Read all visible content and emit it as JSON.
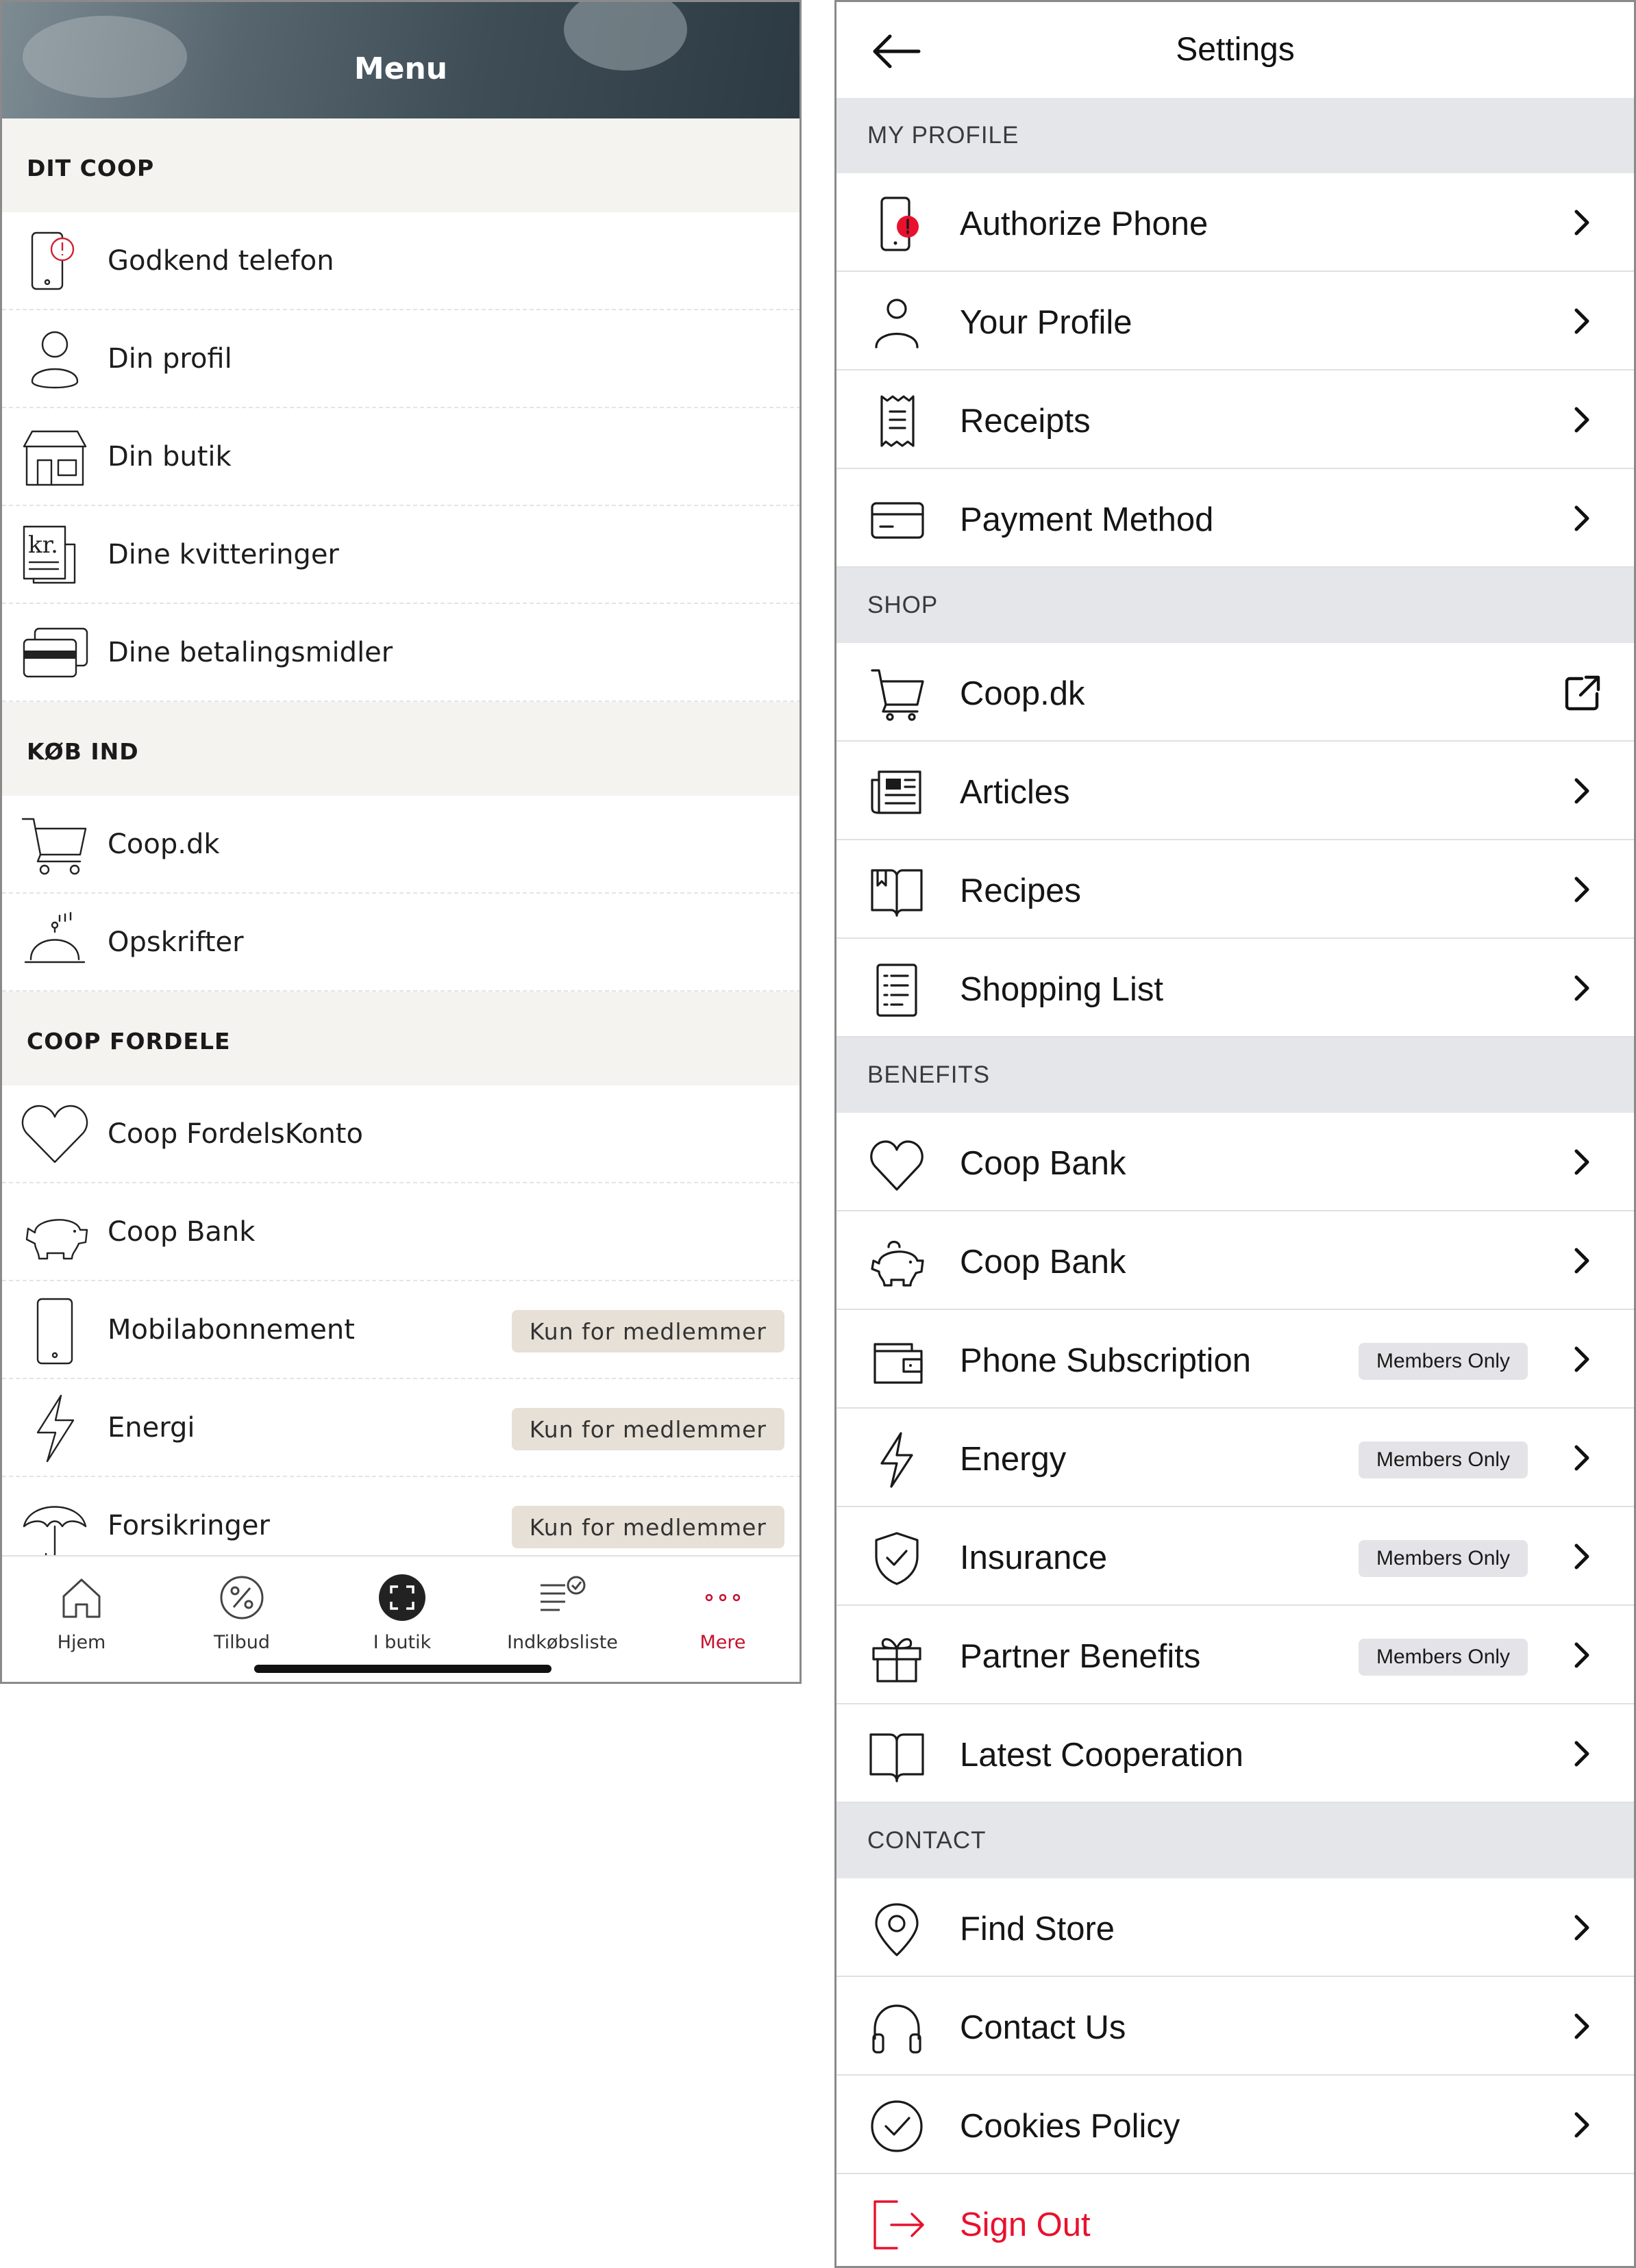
{
  "left_panel": {
    "title": "Menu",
    "sections": [
      {
        "header": "DIT COOP",
        "items": [
          {
            "label": "Godkend telefon",
            "icon": "phone-alert-icon"
          },
          {
            "label": "Din profil",
            "icon": "person-icon"
          },
          {
            "label": "Din butik",
            "icon": "store-icon"
          },
          {
            "label": "Dine kvitteringer",
            "icon": "receipt-kr-icon"
          },
          {
            "label": "Dine betalingsmidler",
            "icon": "cards-icon"
          }
        ]
      },
      {
        "header": "KØB IND",
        "items": [
          {
            "label": "Coop.dk",
            "icon": "cart-icon"
          },
          {
            "label": "Opskrifter",
            "icon": "cloche-icon"
          }
        ]
      },
      {
        "header": "COOP FORDELE",
        "items": [
          {
            "label": "Coop FordelsKonto",
            "icon": "heart-icon"
          },
          {
            "label": "Coop Bank",
            "icon": "piggy-bank-icon"
          },
          {
            "label": "Mobilabonnement",
            "icon": "mobile-icon",
            "badge": "Kun for medlemmer"
          },
          {
            "label": "Energi",
            "icon": "lightning-icon",
            "badge": "Kun for medlemmer"
          },
          {
            "label": "Forsikringer",
            "icon": "umbrella-icon",
            "badge": "Kun for medlemmer"
          }
        ]
      }
    ],
    "tabs": [
      {
        "label": "Hjem",
        "icon": "home-icon"
      },
      {
        "label": "Tilbud",
        "icon": "percent-icon"
      },
      {
        "label": "I butik",
        "icon": "scan-icon"
      },
      {
        "label": "Indkøbsliste",
        "icon": "list-check-icon"
      },
      {
        "label": "Mere",
        "icon": "more-dots-icon",
        "active": true
      }
    ],
    "active_color": "#c8102e"
  },
  "right_panel": {
    "title": "Settings",
    "sections": [
      {
        "header": "MY PROFILE",
        "items": [
          {
            "label": "Authorize Phone",
            "icon": "phone-alert-icon"
          },
          {
            "label": "Your Profile",
            "icon": "person-icon"
          },
          {
            "label": "Receipts",
            "icon": "receipt-icon"
          },
          {
            "label": "Payment Method",
            "icon": "credit-card-icon"
          }
        ]
      },
      {
        "header": "SHOP",
        "items": [
          {
            "label": "Coop.dk",
            "icon": "cart-icon",
            "external": true
          },
          {
            "label": "Articles",
            "icon": "newspaper-icon"
          },
          {
            "label": "Recipes",
            "icon": "book-bookmark-icon"
          },
          {
            "label": "Shopping List",
            "icon": "list-icon"
          }
        ]
      },
      {
        "header": "BENEFITS",
        "items": [
          {
            "label": "Coop Bank",
            "icon": "heart-icon"
          },
          {
            "label": "Coop Bank",
            "icon": "piggy-bank-icon"
          },
          {
            "label": "Phone Subscription",
            "icon": "wallet-icon",
            "badge": "Members Only"
          },
          {
            "label": "Energy",
            "icon": "lightning-icon",
            "badge": "Members Only"
          },
          {
            "label": "Insurance",
            "icon": "shield-check-icon",
            "badge": "Members Only"
          },
          {
            "label": "Partner Benefits",
            "icon": "gift-icon",
            "badge": "Members Only"
          },
          {
            "label": "Latest Cooperation",
            "icon": "open-book-icon"
          }
        ]
      },
      {
        "header": "CONTACT",
        "items": [
          {
            "label": "Find Store",
            "icon": "location-pin-icon"
          },
          {
            "label": "Contact Us",
            "icon": "headphones-icon"
          },
          {
            "label": "Cookies Policy",
            "icon": "check-circle-icon"
          }
        ]
      }
    ],
    "sign_out": {
      "label": "Sign Out",
      "icon": "sign-out-icon"
    },
    "danger_color": "#e8112d"
  }
}
